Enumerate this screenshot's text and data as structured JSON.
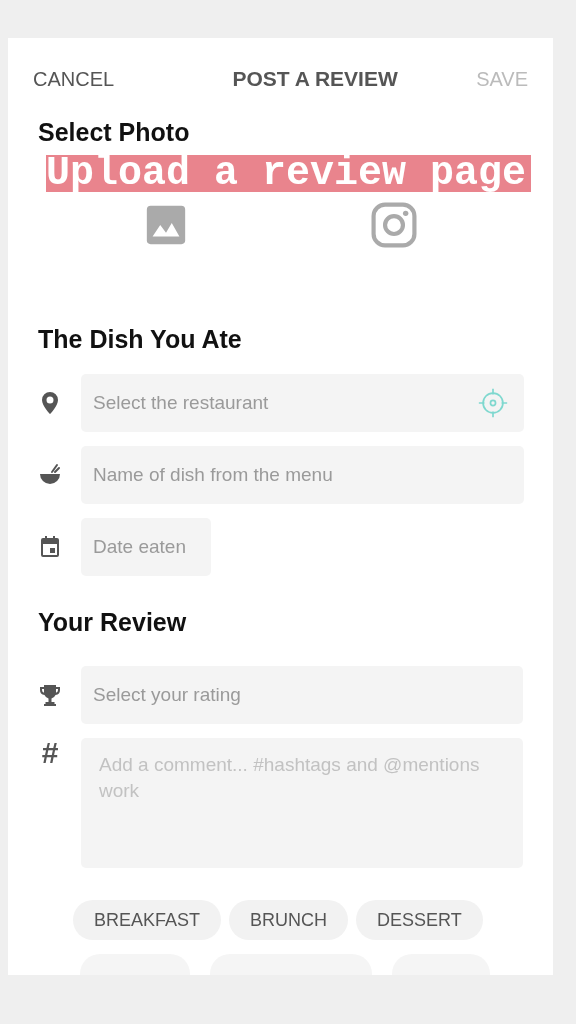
{
  "header": {
    "cancel": "CANCEL",
    "title": "POST A REVIEW",
    "save": {
      "label": "SAVE",
      "disabled": true
    }
  },
  "photo_section": {
    "title": "Select Photo",
    "banner": "Upload a review page",
    "sources": [
      {
        "kind": "gallery"
      },
      {
        "kind": "instagram"
      }
    ]
  },
  "dish_section": {
    "title": "The Dish You Ate",
    "fields": [
      {
        "kind": "restaurant",
        "placeholder": "Select the restaurant"
      },
      {
        "kind": "dish",
        "placeholder": "Name of dish from the menu"
      },
      {
        "kind": "date",
        "placeholder": "Date eaten"
      }
    ]
  },
  "review_section": {
    "title": "Your Review",
    "rating": {
      "placeholder": "Select your rating"
    },
    "comment": {
      "icon": "#",
      "placeholder": "Add a comment... #hashtags and @mentions work"
    }
  },
  "tags": [
    {
      "label": "BREAKFAST"
    },
    {
      "label": "BRUNCH"
    },
    {
      "label": "DESSERT"
    }
  ]
}
